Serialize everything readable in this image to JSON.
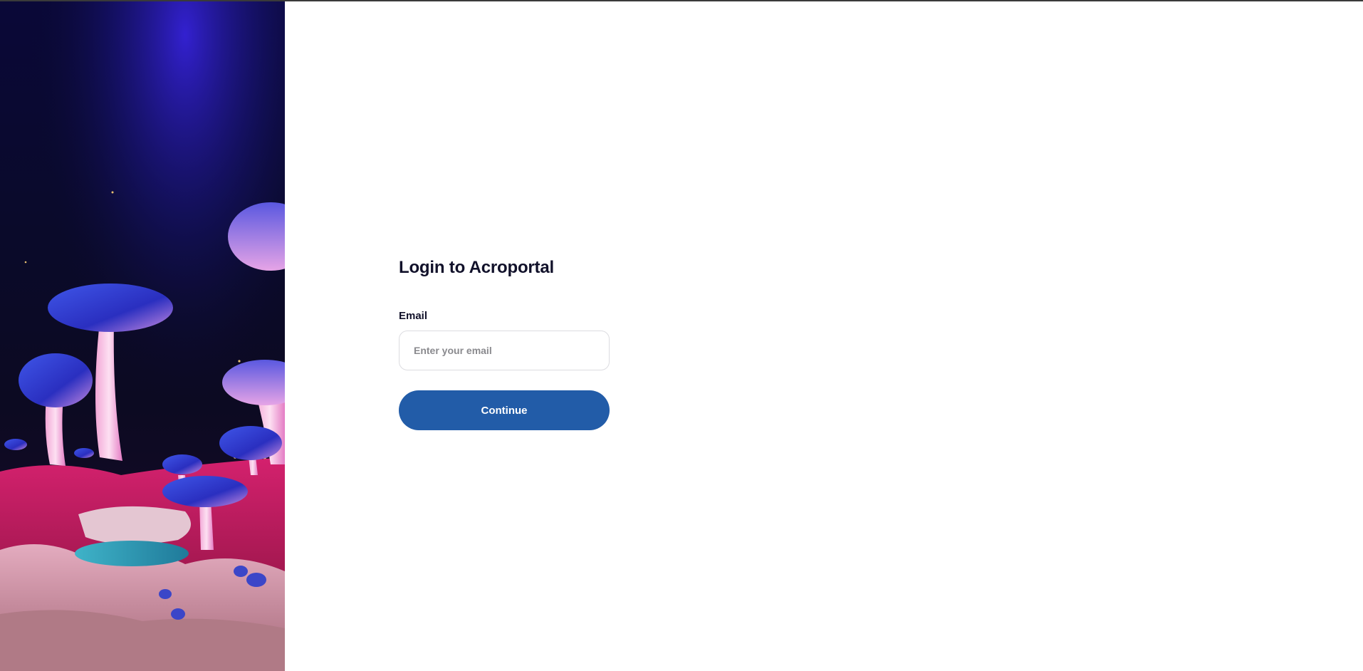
{
  "login": {
    "title": "Login to Acroportal",
    "email_label": "Email",
    "email_placeholder": "Enter your email",
    "email_value": "",
    "continue_label": "Continue"
  },
  "colors": {
    "primary_button": "#225ca8",
    "title_text": "#11112a",
    "input_border": "#dcdce0",
    "hero_sky": "#0a0838"
  },
  "hero": {
    "image": "fantasy-mushroom-landscape"
  }
}
